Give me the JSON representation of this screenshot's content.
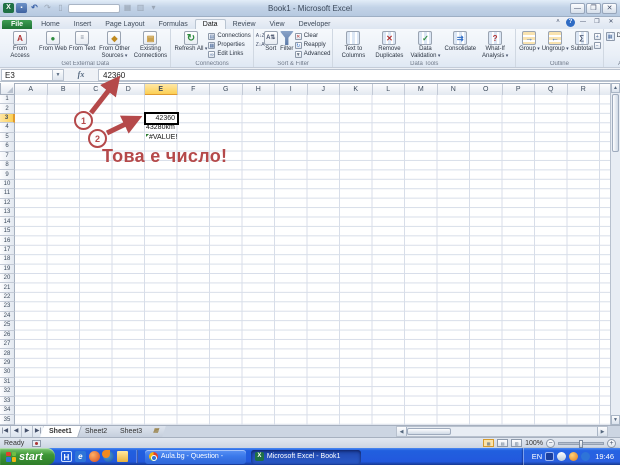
{
  "window": {
    "title": "Book1  -  Microsoft Excel"
  },
  "colors": {
    "annotation_red": "#b5494a",
    "selected_header": "#fbcf54",
    "excel_green": "#1f7145",
    "taskbar_blue": "#2258dd",
    "start_green": "#3e9637"
  },
  "ribbon": {
    "tabs": [
      {
        "label": "File",
        "file": true
      },
      {
        "label": "Home"
      },
      {
        "label": "Insert"
      },
      {
        "label": "Page Layout"
      },
      {
        "label": "Formulas"
      },
      {
        "label": "Data",
        "active": true
      },
      {
        "label": "Review"
      },
      {
        "label": "View"
      },
      {
        "label": "Developer"
      }
    ],
    "groups": [
      {
        "label": "Get External Data",
        "items": [
          {
            "t": "lg",
            "label": "From Access",
            "icon": "access"
          },
          {
            "t": "lg",
            "label": "From Web",
            "icon": "web"
          },
          {
            "t": "lg",
            "label": "From Text",
            "icon": "text"
          },
          {
            "t": "lg",
            "label": "From Other Sources",
            "icon": "sources",
            "arrow": true
          },
          {
            "t": "lg",
            "label": "Existing Connections",
            "icon": "existing"
          }
        ]
      },
      {
        "label": "Connections",
        "items": [
          {
            "t": "lg",
            "label": "Refresh All",
            "icon": "refresh",
            "arrow": true
          },
          {
            "t": "stack",
            "items": [
              {
                "label": "Connections",
                "icon": "conn"
              },
              {
                "label": "Properties",
                "icon": "props"
              },
              {
                "label": "Edit Links",
                "icon": "links"
              }
            ]
          }
        ]
      },
      {
        "label": "Sort & Filter",
        "items": [
          {
            "t": "stack",
            "items": [
              {
                "label": "",
                "icon": "az"
              },
              {
                "label": "",
                "icon": "za"
              }
            ]
          },
          {
            "t": "lg",
            "label": "Sort",
            "icon": "sort"
          },
          {
            "t": "lg",
            "label": "Filter",
            "icon": "filter"
          },
          {
            "t": "stack",
            "items": [
              {
                "label": "Clear",
                "icon": "clear"
              },
              {
                "label": "Reapply",
                "icon": "reapply"
              },
              {
                "label": "Advanced",
                "icon": "advanced"
              }
            ]
          }
        ]
      },
      {
        "label": "Data Tools",
        "items": [
          {
            "t": "lg",
            "label": "Text to Columns",
            "icon": "ttc"
          },
          {
            "t": "lg",
            "label": "Remove Duplicates",
            "icon": "dup"
          },
          {
            "t": "lg",
            "label": "Data Validation",
            "icon": "valid",
            "arrow": true
          },
          {
            "t": "lg",
            "label": "Consolidate",
            "icon": "consol"
          },
          {
            "t": "lg",
            "label": "What-If Analysis",
            "icon": "whatif",
            "arrow": true
          }
        ]
      },
      {
        "label": "Outline",
        "items": [
          {
            "t": "lg",
            "label": "Group",
            "icon": "group",
            "arrow": true
          },
          {
            "t": "lg",
            "label": "Ungroup",
            "icon": "ungroup",
            "arrow": true
          },
          {
            "t": "lg",
            "label": "Subtotal",
            "icon": "subtotal"
          },
          {
            "t": "stack",
            "items": [
              {
                "label": "",
                "icon": "showdet"
              },
              {
                "label": "",
                "icon": "hidedet"
              }
            ]
          }
        ]
      },
      {
        "label": "Analysis",
        "items": [
          {
            "t": "stack",
            "items": [
              {
                "label": "Data Analysis",
                "icon": "da"
              }
            ]
          }
        ]
      }
    ]
  },
  "formula_bar": {
    "cell_ref": "E3",
    "fx_label": "fx",
    "value": "42360"
  },
  "grid": {
    "columns": [
      "A",
      "B",
      "C",
      "D",
      "E",
      "F",
      "G",
      "H",
      "I",
      "J",
      "K",
      "L",
      "M",
      "N",
      "O",
      "P",
      "Q",
      "R",
      "S"
    ],
    "row_count": 35,
    "active_cell": "E3",
    "cells": {
      "E3": {
        "v": "42360",
        "align": "right",
        "selected": true
      },
      "E4": {
        "v": "43280km",
        "align": "left"
      },
      "E5": {
        "v": "#VALUE!",
        "align": "left",
        "error": true
      }
    }
  },
  "annotations": {
    "badge1": "1",
    "badge2": "2",
    "caption": "Това е число!"
  },
  "sheet_bar": {
    "tabs": [
      {
        "label": "Sheet1",
        "active": true
      },
      {
        "label": "Sheet2"
      },
      {
        "label": "Sheet3"
      }
    ]
  },
  "status_bar": {
    "mode": "Ready",
    "zoom": "100%"
  },
  "taskbar": {
    "start_label": "start",
    "tasks": [
      {
        "label": "Aula.bg - Question -",
        "icon": "chrome"
      },
      {
        "label": "Microsoft Excel - Book1",
        "icon": "excel",
        "active": true
      }
    ],
    "tray_lang": "EN",
    "clock": "19:46"
  }
}
